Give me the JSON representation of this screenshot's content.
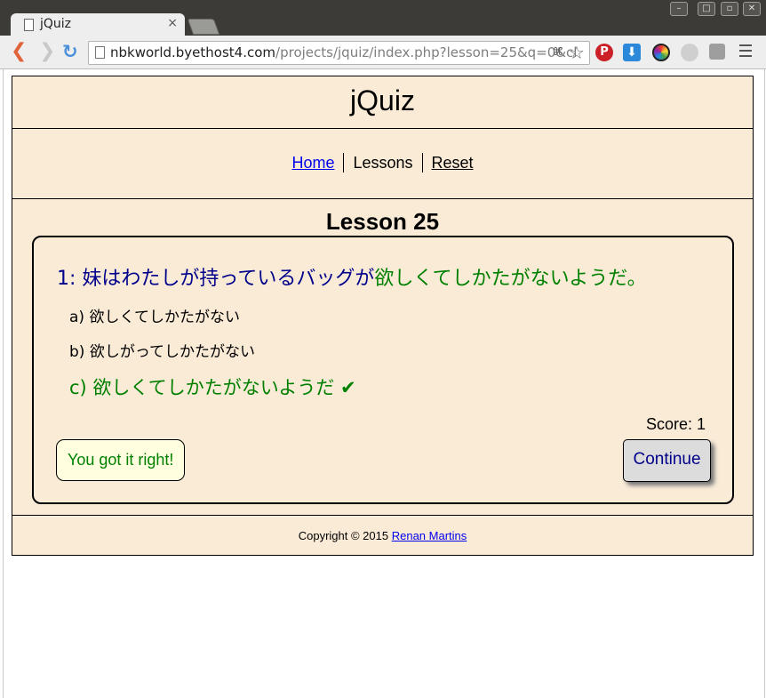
{
  "browser": {
    "tab_title": "jQuiz",
    "tab_close": "×",
    "url_host": "nbkworld.byethost4.com",
    "url_path": "/projects/jquiz/index.php?lesson=25&q=0&cl"
  },
  "site": {
    "title": "jQuiz",
    "nav": {
      "home": "Home",
      "lessons": "Lessons",
      "reset": "Reset"
    },
    "lesson_title": "Lesson 25",
    "question": {
      "number": "1:",
      "text_before": "妹はわたしが持っているバッグが",
      "text_answer": "欲しくてしかたがないようだ。"
    },
    "options": {
      "a": "a) 欲しくてしかたがない",
      "b": "b) 欲しがってしかたがない",
      "c": "c) 欲しくてしかたがないようだ ✔"
    },
    "score": "Score: 1",
    "feedback": "You got it right!",
    "continue": "Continue",
    "footer": {
      "copyright": "Copyright © 2015 ",
      "author": "Renan Martins"
    }
  },
  "colors": {
    "page_bg": "#faebd7",
    "correct": "#008000",
    "question": "#00008b",
    "link": "#0000ee"
  }
}
